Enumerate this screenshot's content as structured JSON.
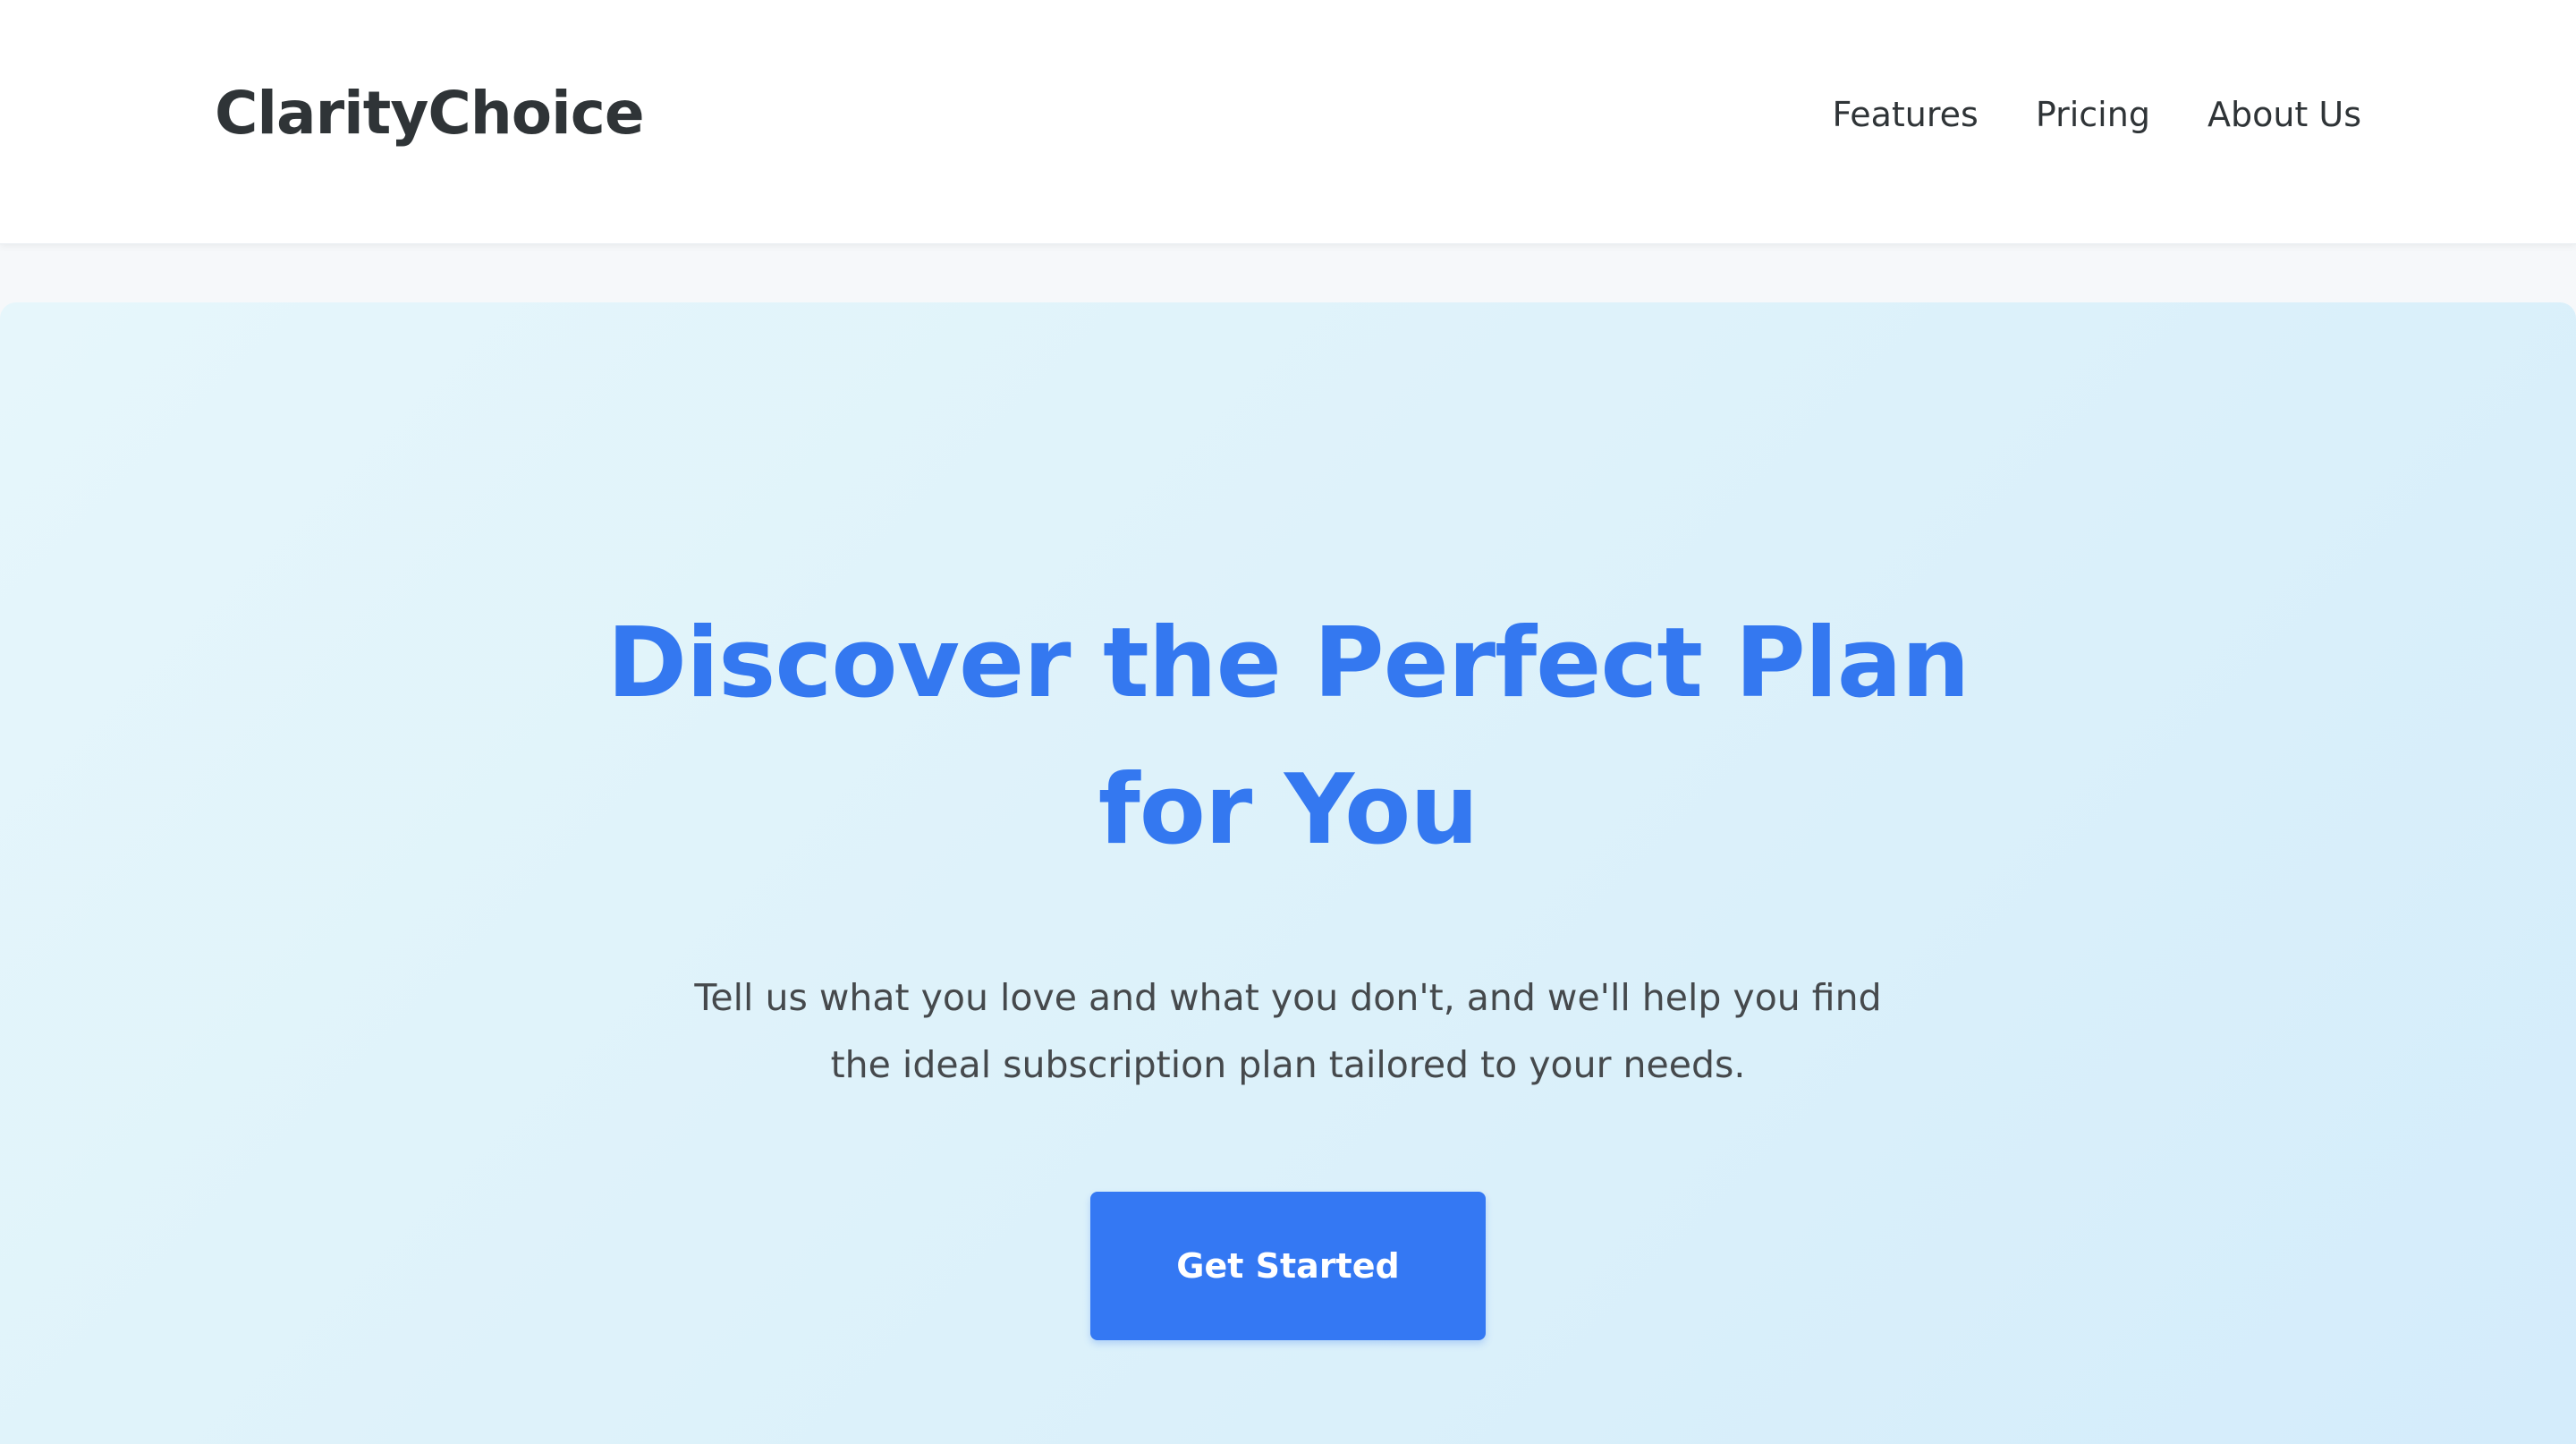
{
  "header": {
    "brand": "ClarityChoice",
    "nav": [
      {
        "label": "Features"
      },
      {
        "label": "Pricing"
      },
      {
        "label": "About Us"
      }
    ]
  },
  "hero": {
    "title": "Discover the Perfect Plan for You",
    "subtitle": "Tell us what you love and what you don't, and we'll help you find the ideal subscription plan tailored to your needs.",
    "cta_label": "Get Started"
  },
  "colors": {
    "accent": "#3478f0",
    "brand_text": "#2f3437",
    "hero_background": "#dcf1fa"
  }
}
